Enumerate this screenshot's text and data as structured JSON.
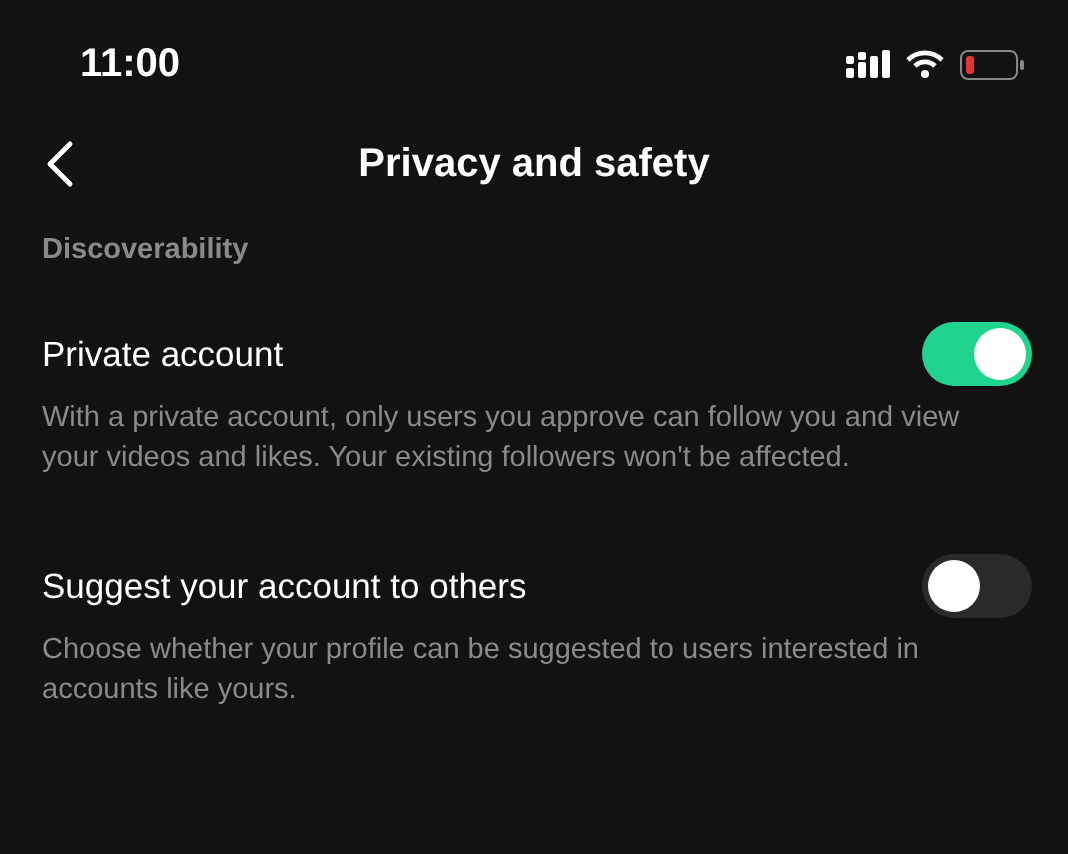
{
  "status_bar": {
    "time": "11:00"
  },
  "header": {
    "title": "Privacy and safety"
  },
  "section": {
    "title": "Discoverability"
  },
  "settings": [
    {
      "label": "Private account",
      "description": "With a private account, only users you approve can follow you and view your videos and likes. Your existing followers won't be affected.",
      "on": true
    },
    {
      "label": "Suggest your account to others",
      "description": "Choose whether your profile can be suggested to users interested in accounts like yours.",
      "on": false
    }
  ]
}
